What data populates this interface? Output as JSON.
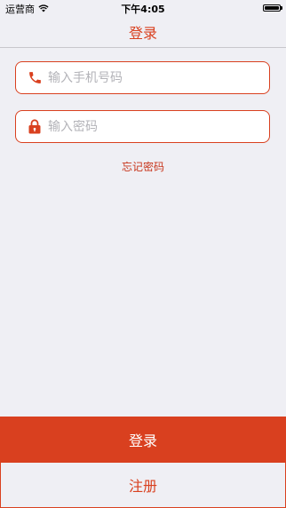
{
  "status_bar": {
    "carrier": "运营商",
    "time": "下午4:05",
    "wifi_icon": "wifi-icon",
    "battery_icon": "battery-icon"
  },
  "nav": {
    "title": "登录"
  },
  "form": {
    "phone": {
      "icon": "phone-icon",
      "placeholder": "输入手机号码",
      "value": ""
    },
    "password": {
      "icon": "lock-icon",
      "placeholder": "输入密码",
      "value": ""
    },
    "forgot_label": "忘记密码"
  },
  "actions": {
    "login_label": "登录",
    "register_label": "注册"
  },
  "colors": {
    "accent": "#d9401f",
    "background": "#efeff4"
  }
}
